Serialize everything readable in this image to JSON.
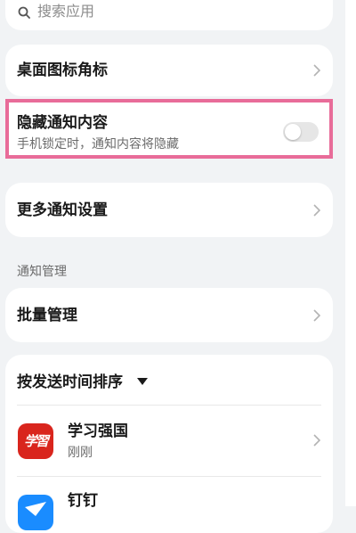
{
  "search": {
    "placeholder": "搜索应用",
    "icon": "search-icon"
  },
  "settings": {
    "badge_label": "桌面图标角标",
    "hide_content_label": "隐藏通知内容",
    "hide_content_desc": "手机锁定时，通知内容将隐藏",
    "hide_content_enabled": false,
    "more_label": "更多通知设置"
  },
  "section": {
    "label": "通知管理"
  },
  "batch": {
    "label": "批量管理"
  },
  "apps": {
    "sort_label": "按发送时间排序",
    "items": [
      {
        "name": "学习强国",
        "time": "刚刚",
        "icon": "xuexi-qiangguo-app-icon",
        "icon_text": "学習"
      },
      {
        "name": "钉钉",
        "time": "",
        "icon": "dingtalk-app-icon"
      }
    ]
  },
  "colors": {
    "background": "#f1f3f5",
    "card": "#ffffff",
    "highlight_border": "#e86c99",
    "xuexi_red": "#d9251d",
    "dingtalk_blue": "#1a8cff",
    "toggle_off": "#e6e6e6"
  }
}
